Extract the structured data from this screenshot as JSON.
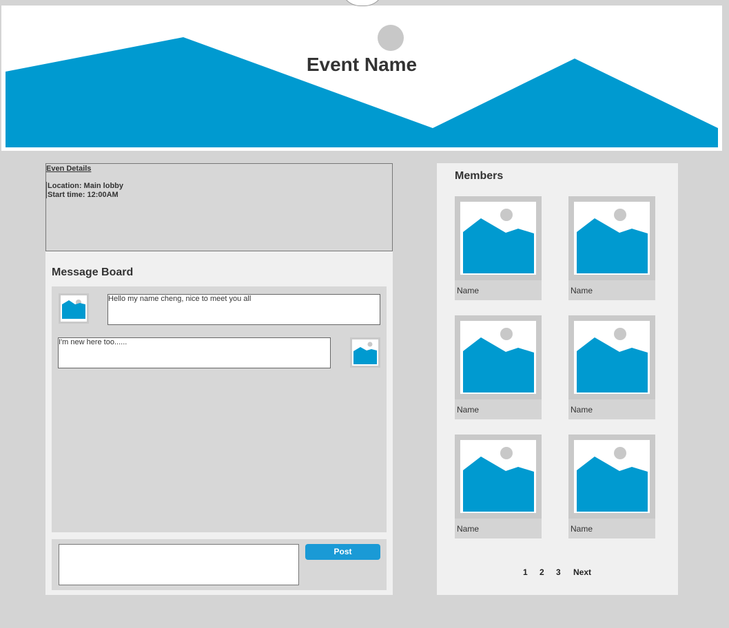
{
  "header": {
    "title": "Event Name"
  },
  "details": {
    "title": "Even Details",
    "location": "Location: Main lobby",
    "start_time": "Start time: 12:00AM"
  },
  "message_board": {
    "title": "Message Board",
    "messages": [
      {
        "text": "Hello my name cheng, nice to meet you all"
      },
      {
        "text": "I'm new here too......"
      }
    ],
    "post_input": {
      "value": ""
    },
    "post_label": "Post"
  },
  "members": {
    "title": "Members",
    "items": [
      {
        "name": "Name"
      },
      {
        "name": "Name"
      },
      {
        "name": "Name"
      },
      {
        "name": "Name"
      },
      {
        "name": "Name"
      },
      {
        "name": "Name"
      }
    ]
  },
  "pagination": {
    "pages": [
      "1",
      "2",
      "3"
    ],
    "next": "Next"
  },
  "colors": {
    "accent": "#009ad0",
    "button": "#1a9ad6",
    "panel": "#d7d7d7",
    "background": "#d4d4d4"
  }
}
